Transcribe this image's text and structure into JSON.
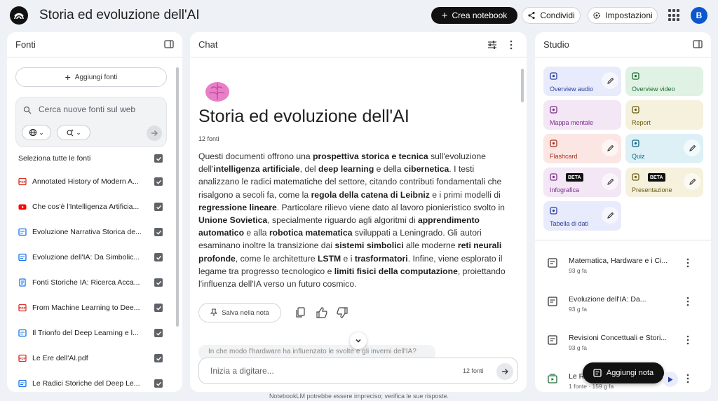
{
  "header": {
    "title": "Storia ed evoluzione dell'AI",
    "create_label": "Crea notebook",
    "share_label": "Condividi",
    "settings_label": "Impostazioni",
    "avatar_initial": "B"
  },
  "sources": {
    "title": "Fonti",
    "add_label": "Aggiungi fonti",
    "search_placeholder": "Cerca nuove fonti sul web",
    "select_all_label": "Seleziona tutte le fonti",
    "items": [
      {
        "label": "Annotated History of Modern A...",
        "icon": "pdf-icon"
      },
      {
        "label": "Che cos'è l'Intelligenza Artificia...",
        "icon": "youtube-icon"
      },
      {
        "label": "Evoluzione Narrativa Storica de...",
        "icon": "doc-icon"
      },
      {
        "label": "Evoluzione dell'IA: Da Simbolic...",
        "icon": "doc-icon"
      },
      {
        "label": "Fonti Storiche IA: Ricerca Acca...",
        "icon": "text-icon"
      },
      {
        "label": "From Machine Learning to Dee...",
        "icon": "pdf-icon"
      },
      {
        "label": "Il Trionfo del Deep Learning e l...",
        "icon": "doc-icon"
      },
      {
        "label": "Le Ere dell'AI.pdf",
        "icon": "pdf-icon"
      },
      {
        "label": "Le Radici Storiche del Deep Le...",
        "icon": "doc-icon"
      }
    ]
  },
  "chat": {
    "title": "Chat",
    "heading": "Storia ed evoluzione dell'AI",
    "source_count": "12 fonti",
    "body": [
      {
        "t": "Questi documenti offrono una ",
        "b": false
      },
      {
        "t": "prospettiva storica e tecnica",
        "b": true
      },
      {
        "t": " sull'evoluzione dell'",
        "b": false
      },
      {
        "t": "intelligenza artificiale",
        "b": true
      },
      {
        "t": ", del ",
        "b": false
      },
      {
        "t": "deep learning",
        "b": true
      },
      {
        "t": " e della ",
        "b": false
      },
      {
        "t": "cibernetica",
        "b": true
      },
      {
        "t": ". I testi analizzano le radici matematiche del settore, citando contributi fondamentali che risalgono a secoli fa, come la ",
        "b": false
      },
      {
        "t": "regola della catena di Leibniz",
        "b": true
      },
      {
        "t": " e i primi modelli di ",
        "b": false
      },
      {
        "t": "regressione lineare",
        "b": true
      },
      {
        "t": ". Particolare rilievo viene dato al lavoro pionieristico svolto in ",
        "b": false
      },
      {
        "t": "Unione Sovietica",
        "b": true
      },
      {
        "t": ", specialmente riguardo agli algoritmi di ",
        "b": false
      },
      {
        "t": "apprendimento automatico",
        "b": true
      },
      {
        "t": " e alla ",
        "b": false
      },
      {
        "t": "robotica matematica",
        "b": true
      },
      {
        "t": " sviluppati a Leningrado. Gli autori esaminano inoltre la transizione dai ",
        "b": false
      },
      {
        "t": "sistemi simbolici",
        "b": true
      },
      {
        "t": " alle moderne ",
        "b": false
      },
      {
        "t": "reti neurali profonde",
        "b": true
      },
      {
        "t": ", come le architetture ",
        "b": false
      },
      {
        "t": "LSTM",
        "b": true
      },
      {
        "t": " e i ",
        "b": false
      },
      {
        "t": "trasformatori",
        "b": true
      },
      {
        "t": ". Infine, viene esplorato il legame tra progresso tecnologico e ",
        "b": false
      },
      {
        "t": "limiti fisici della computazione",
        "b": true
      },
      {
        "t": ", proiettando l'influenza dell'IA verso un futuro cosmico.",
        "b": false
      }
    ],
    "save_note_label": "Salva nella nota",
    "suggested_question": "In che modo l'hardware ha influenzato le svolte e gli inverni dell'IA?",
    "input_placeholder": "Inizia a digitare...",
    "input_count": "12 fonti"
  },
  "studio": {
    "title": "Studio",
    "tiles": [
      {
        "label": "Overview audio",
        "bg": "#e8ebfb",
        "fg": "#2c3e9c",
        "edit": true,
        "beta": false
      },
      {
        "label": "Overview video",
        "bg": "#e0f2e3",
        "fg": "#1f6a35",
        "edit": false,
        "beta": false
      },
      {
        "label": "Mappa mentale",
        "bg": "#f3e6f5",
        "fg": "#7c2f8a",
        "edit": false,
        "beta": false
      },
      {
        "label": "Report",
        "bg": "#f5f1dc",
        "fg": "#6b5b14",
        "edit": false,
        "beta": false
      },
      {
        "label": "Flashcard",
        "bg": "#fbe6e3",
        "fg": "#a3321f",
        "edit": true,
        "beta": false
      },
      {
        "label": "Quiz",
        "bg": "#dcf0f6",
        "fg": "#0e6580",
        "edit": true,
        "beta": false
      },
      {
        "label": "Infografica",
        "bg": "#f3e6f5",
        "fg": "#7c2f8a",
        "edit": true,
        "beta": true
      },
      {
        "label": "Presentazione",
        "bg": "#f5f1dc",
        "fg": "#6b5b14",
        "edit": true,
        "beta": true
      },
      {
        "label": "Tabella di dati",
        "bg": "#e8ebfb",
        "fg": "#2c3e9c",
        "edit": true,
        "beta": false
      }
    ],
    "beta_label": "BETA",
    "notes": [
      {
        "title": "Matematica, Hardware e i Ci...",
        "sub": "93 g fa"
      },
      {
        "title": "Evoluzione dell'IA: Da...",
        "sub": "93 g fa"
      },
      {
        "title": "Revisioni Concettuali e Stori...",
        "sub": "93 g fa"
      },
      {
        "title": "Le R",
        "sub": "1 fonte · 159 g fa"
      }
    ],
    "add_note_label": "Aggiungi nota"
  },
  "footer": {
    "text": "NotebookLM potrebbe essere impreciso; verifica le sue risposte."
  }
}
